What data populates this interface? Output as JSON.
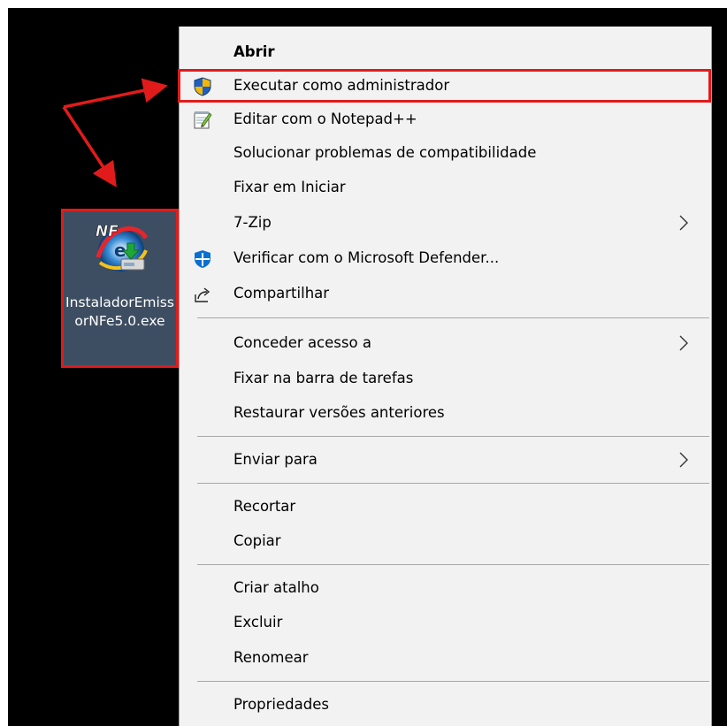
{
  "desktop": {
    "file": {
      "name": "InstaladorEmissorNFe5.0.exe",
      "icon": "nfe-installer-icon",
      "selected": true
    }
  },
  "context_menu": {
    "items": [
      {
        "label": "Abrir",
        "bold": true
      },
      {
        "label": "Executar como administrador",
        "icon": "uac-shield-icon",
        "highlighted": true
      },
      {
        "label": "Editar com o Notepad++",
        "icon": "notepad-plus-plus-icon"
      },
      {
        "label": "Solucionar problemas de compatibilidade"
      },
      {
        "label": "Fixar em Iniciar"
      },
      {
        "label": "7-Zip",
        "submenu": true
      },
      {
        "label": "Verificar com o Microsoft Defender...",
        "icon": "defender-shield-icon"
      },
      {
        "label": "Compartilhar",
        "icon": "share-icon"
      },
      {
        "label": "Conceder acesso a",
        "submenu": true
      },
      {
        "label": "Fixar na barra de tarefas"
      },
      {
        "label": "Restaurar versões anteriores"
      },
      {
        "label": "Enviar para",
        "submenu": true
      },
      {
        "label": "Recortar"
      },
      {
        "label": "Copiar"
      },
      {
        "label": "Criar atalho"
      },
      {
        "label": "Excluir"
      },
      {
        "label": "Renomear"
      },
      {
        "label": "Propriedades"
      }
    ]
  },
  "annotation": {
    "color": "#e11b1b",
    "arrow": "red-double-arrow"
  }
}
